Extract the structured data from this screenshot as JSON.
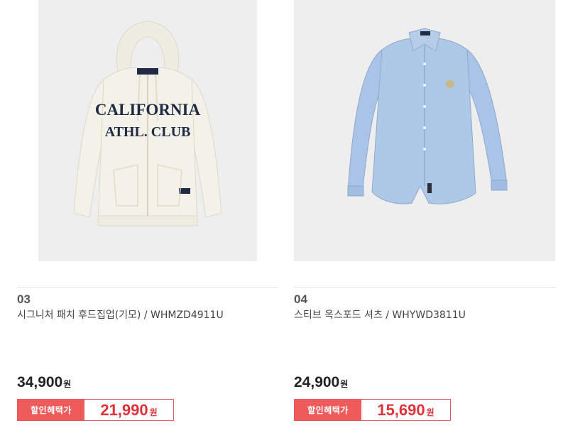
{
  "products": [
    {
      "number": "03",
      "name": "시그니처 패치 후드집업(기모) / WHMZD4911U",
      "image_alt": "cream hoodie with navy CALIFORNIA ATHL. CLUB lettering",
      "print_line1": "CALIFORNIA",
      "print_line2": "ATHL. CLUB",
      "price": "34,900",
      "currency": "원",
      "discount_label": "할인혜택가",
      "discount_price": "21,990"
    },
    {
      "number": "04",
      "name": "스티브 옥스포드 셔츠 / WHYWD3811U",
      "image_alt": "light blue oxford button-down shirt",
      "price": "24,900",
      "currency": "원",
      "discount_label": "할인혜택가",
      "discount_price": "15,690"
    }
  ],
  "colors": {
    "thumb_bg": "#eeeeee",
    "discount_bg": "#ef5b5b",
    "discount_price": "#e0323a",
    "hoodie": "#f3f1e8",
    "hoodie_print": "#1f2a44",
    "shirt": "#a9c4e6"
  }
}
